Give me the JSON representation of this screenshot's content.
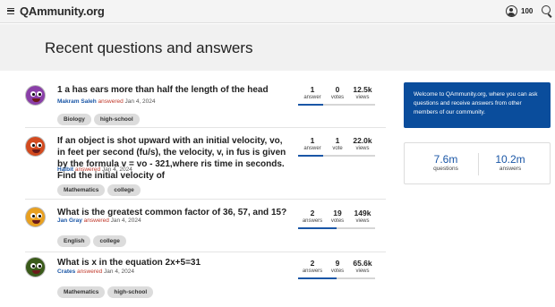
{
  "header": {
    "logo": "QAmmunity.org",
    "points": "100"
  },
  "page": {
    "title": "Recent questions and answers"
  },
  "questions": [
    {
      "title": "1 a has ears more than half the length of the head",
      "author": "Makram Saleh",
      "answered": "answered",
      "date": "Jan 4, 2024",
      "tags": [
        "Biology",
        "high-school"
      ],
      "answers": "1",
      "answers_label": "answer",
      "votes": "0",
      "votes_label": "votes",
      "views": "12.5k",
      "views_label": "views",
      "progress": 0.33
    },
    {
      "title": "If an object is shot upward with an initial velocity, vo, in feet per second (fu/s), the velocity, v, in fus is given by the formula v = vo - 321,where ris time in seconds. Find the initial velocity of",
      "author": "Halbit",
      "answered": "answered",
      "date": "Jan 4, 2024",
      "tags": [
        "Mathematics",
        "college"
      ],
      "answers": "1",
      "answers_label": "answer",
      "votes": "1",
      "votes_label": "vote",
      "views": "22.0k",
      "views_label": "views",
      "progress": 0.33
    },
    {
      "title": "What is the greatest common factor of 36, 57, and 15?",
      "author": "Jan Gray",
      "answered": "answered",
      "date": "Jan 4, 2024",
      "tags": [
        "English",
        "college"
      ],
      "answers": "2",
      "answers_label": "answers",
      "votes": "19",
      "votes_label": "votes",
      "views": "149k",
      "views_label": "views",
      "progress": 0.5
    },
    {
      "title": "What is x in the equation 2x+5=31",
      "author": "Crates",
      "answered": "answered",
      "date": "Jan 4, 2024",
      "tags": [
        "Mathematics",
        "high-school"
      ],
      "answers": "2",
      "answers_label": "answers",
      "votes": "9",
      "votes_label": "votes",
      "views": "65.6k",
      "views_label": "views",
      "progress": 0.5
    }
  ],
  "sidebar": {
    "welcome": "Welcome to QAmmunity.org, where you can ask questions and receive answers from other members of our community.",
    "questions_count": "7.6m",
    "questions_label": "questions",
    "answers_count": "10.2m",
    "answers_label": "answers"
  },
  "colors": {
    "accent": "#0a4d9c",
    "author": "#1a56a6",
    "answered": "#c0392b"
  },
  "avatars": [
    {
      "face": "#8a3fa8"
    },
    {
      "face": "#d24a1f"
    },
    {
      "face": "#e8a020"
    },
    {
      "face": "#3a5a1a"
    }
  ]
}
